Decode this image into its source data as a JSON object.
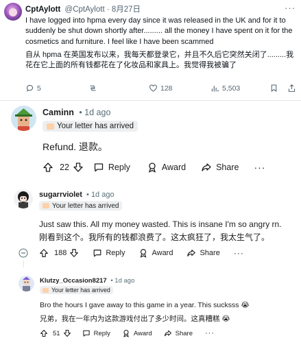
{
  "tweet": {
    "name": "CptAylott",
    "handle": "@CptAylott · 8月27日",
    "text": "I have logged into hpma every day since it was released in the UK and for it to suddenly be shut down shortly after......... all the money I have spent on it for the cosmetics and furniture. I feel like I have been scammed",
    "text_zh": "自从 hpma 在英国发布以来，我每天都登录它，并且不久后它突然关闭了.........我花在它上面的所有钱都花在了化妆品和家具上。我觉得我被骗了",
    "replies": "5",
    "likes": "128",
    "views": "5,503",
    "more": "···"
  },
  "comments": [
    {
      "user": "Caminn",
      "time": "• 1d ago",
      "flair": "Your letter has arrived",
      "body": "Refund. 退款。",
      "votes": "22",
      "reply": "Reply",
      "award": "Award",
      "share": "Share",
      "more": "···"
    },
    {
      "user": "sugarrviolet",
      "time": "• 1d ago",
      "flair": "Your letter has arrived",
      "body": "Just saw this. All my money wasted. This is insane I'm so angry rn.",
      "body_zh": "刚看到这个。我所有的钱都浪费了。这太疯狂了，我太生气了。",
      "votes": "188",
      "reply": "Reply",
      "award": "Award",
      "share": "Share",
      "more": "···"
    },
    {
      "user": "Klutzy_Occasion8217",
      "time": "• 1d ago",
      "flair": "Your letter has arrived",
      "body": "Bro the hours I gave away to this game in a year. This sucksss 😭",
      "body_zh": "兄弟，我在一年内为这款游戏付出了多少时间。这真糟糕 😭",
      "votes": "51",
      "reply": "Reply",
      "award": "Award",
      "share": "Share",
      "more": "···"
    }
  ],
  "colors": {
    "flair_bg": "#edeff1",
    "meta": "#576f76",
    "twitter_gray": "#536471"
  },
  "icons": [
    "reply-icon",
    "retweet-icon",
    "like-icon",
    "views-icon",
    "bookmark-icon",
    "share-icon",
    "upvote-icon",
    "downvote-icon",
    "comment-icon",
    "award-icon",
    "share-arrow-icon",
    "collapse-icon"
  ]
}
